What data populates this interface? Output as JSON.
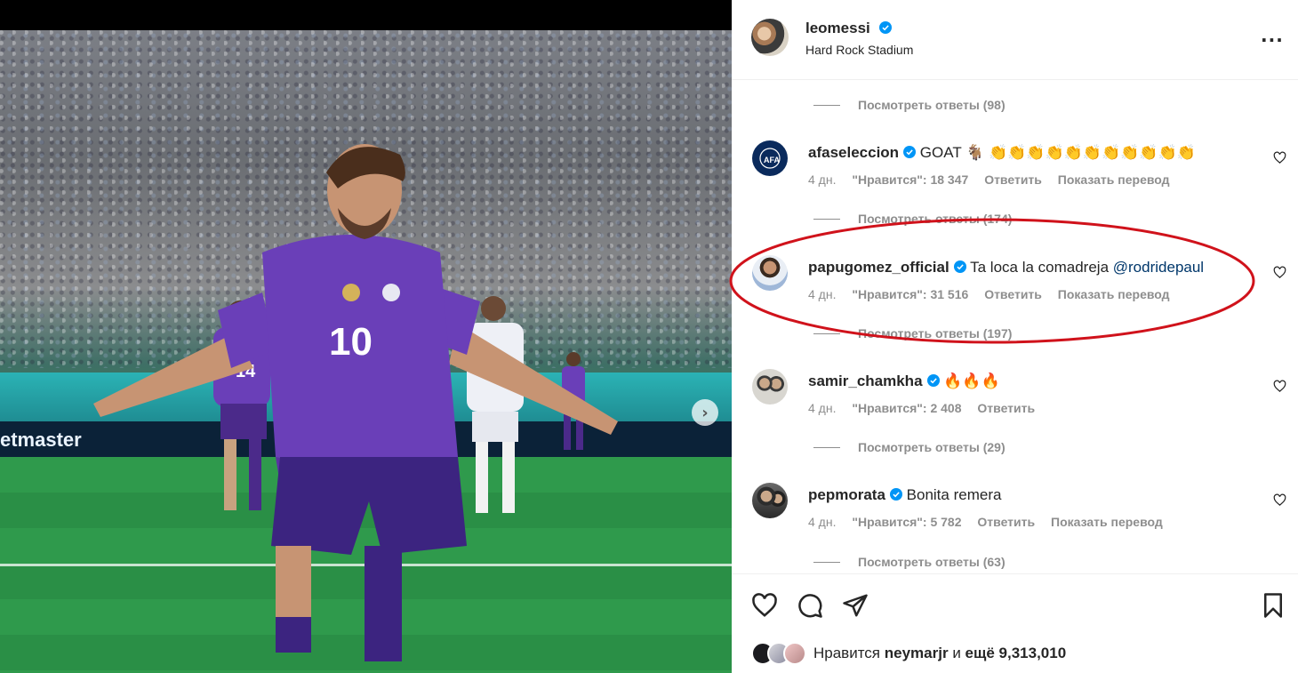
{
  "post": {
    "username": "leomessi",
    "location": "Hard Rock Stadium",
    "more_icon": "more-horizontal-icon"
  },
  "media": {
    "ad_text": "etmaster",
    "jersey_number": "10"
  },
  "replies": [
    {
      "label": "Посмотреть ответы (98)"
    },
    {
      "label": "Посмотреть ответы (174)"
    },
    {
      "label": "Посмотреть ответы (197)"
    },
    {
      "label": "Посмотреть ответы (29)"
    },
    {
      "label": "Посмотреть ответы (63)"
    }
  ],
  "comments": [
    {
      "username": "afaseleccion",
      "text": "GOAT 🐐 👏👏👏👏👏👏👏👏👏👏👏",
      "mention": "",
      "time": "4 дн.",
      "likes": "\"Нравится\": 18 347",
      "reply": "Ответить",
      "translate": "Показать перевод"
    },
    {
      "username": "papugomez_official",
      "text": "Ta loca la comadreja",
      "mention": "@rodridepaul",
      "time": "4 дн.",
      "likes": "\"Нравится\": 31 516",
      "reply": "Ответить",
      "translate": "Показать перевод"
    },
    {
      "username": "samir_chamkha",
      "text": "🔥🔥🔥",
      "mention": "",
      "time": "4 дн.",
      "likes": "\"Нравится\": 2 408",
      "reply": "Ответить",
      "translate": ""
    },
    {
      "username": "pepmorata",
      "text": "Bonita remera",
      "mention": "",
      "time": "4 дн.",
      "likes": "\"Нравится\": 5 782",
      "reply": "Ответить",
      "translate": "Показать перевод"
    }
  ],
  "footer": {
    "likes_prefix": "Нравится",
    "likes_user": "neymarjr",
    "likes_and": "и",
    "likes_more": "ещё 9,313,010",
    "icons": [
      "heart-icon",
      "comment-icon",
      "share-icon",
      "bookmark-icon"
    ]
  },
  "colors": {
    "verified": "#0095f6",
    "annotation": "#d0121b",
    "jersey": "#6a3fb8"
  }
}
